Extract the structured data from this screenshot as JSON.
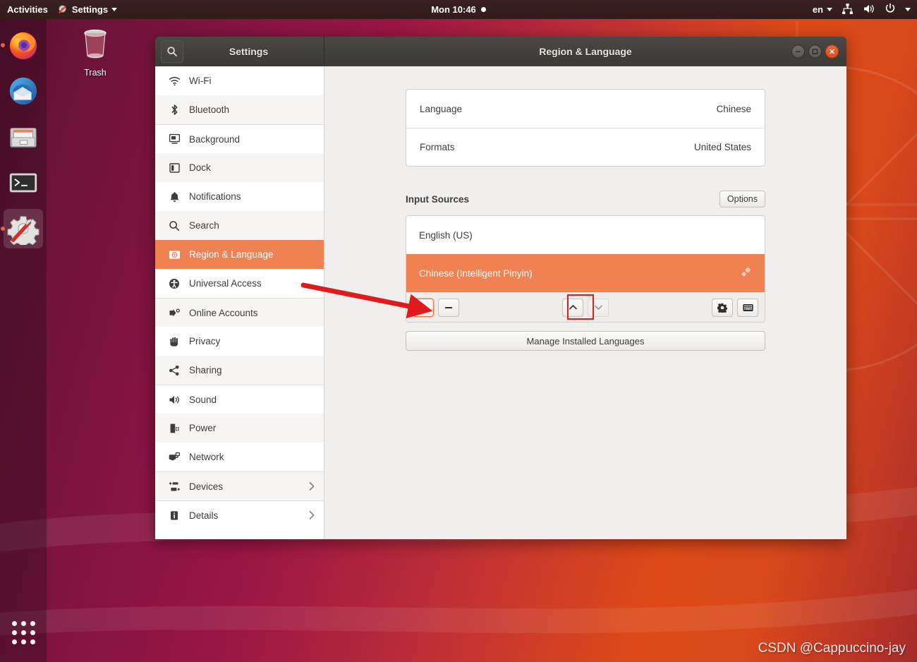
{
  "top_panel": {
    "activities_label": "Activities",
    "app_menu_label": "Settings",
    "app_menu_icon": "settings-icon",
    "clock_label": "Mon 10:46",
    "clock_indicator_icon": "recording-dot-icon",
    "keyboard_layout_label": "en",
    "network_icon": "network-wired-icon",
    "volume_icon": "volume-high-icon",
    "power_icon": "power-icon",
    "menu_caret_icon": "chevron-down-icon"
  },
  "dock": {
    "items": [
      {
        "name": "firefox",
        "label": "Firefox",
        "running": true,
        "active": false
      },
      {
        "name": "thunderbird",
        "label": "Thunderbird",
        "running": false,
        "active": false
      },
      {
        "name": "files",
        "label": "Files",
        "running": false,
        "active": false
      },
      {
        "name": "terminal",
        "label": "Terminal",
        "running": false,
        "active": false
      },
      {
        "name": "settings",
        "label": "Settings",
        "running": true,
        "active": true
      }
    ],
    "app_grid_label": "Show Applications"
  },
  "desktop": {
    "trash_label": "Trash",
    "watermark": "CSDN @Cappuccino-jay"
  },
  "window": {
    "search_icon": "search-icon",
    "sidebar_header_label": "Settings",
    "title": "Region & Language",
    "controls": {
      "minimize_icon": "minimize-icon",
      "maximize_icon": "maximize-icon",
      "close_icon": "close-icon"
    }
  },
  "sidebar": {
    "items": [
      {
        "label": "Wi-Fi",
        "icon": "wifi-icon",
        "selected": false,
        "submenu": false,
        "separator_above": false
      },
      {
        "label": "Bluetooth",
        "icon": "bluetooth-icon",
        "selected": false,
        "submenu": false,
        "separator_above": false
      },
      {
        "label": "Background",
        "icon": "background-icon",
        "selected": false,
        "submenu": false,
        "separator_above": true
      },
      {
        "label": "Dock",
        "icon": "dock-icon",
        "selected": false,
        "submenu": false,
        "separator_above": false
      },
      {
        "label": "Notifications",
        "icon": "bell-icon",
        "selected": false,
        "submenu": false,
        "separator_above": false
      },
      {
        "label": "Search",
        "icon": "search-icon",
        "selected": false,
        "submenu": false,
        "separator_above": false
      },
      {
        "label": "Region & Language",
        "icon": "region-language-icon",
        "selected": true,
        "submenu": false,
        "separator_above": false
      },
      {
        "label": "Universal Access",
        "icon": "accessibility-icon",
        "selected": false,
        "submenu": false,
        "separator_above": false
      },
      {
        "label": "Online Accounts",
        "icon": "online-accounts-icon",
        "selected": false,
        "submenu": false,
        "separator_above": true
      },
      {
        "label": "Privacy",
        "icon": "privacy-hand-icon",
        "selected": false,
        "submenu": false,
        "separator_above": false
      },
      {
        "label": "Sharing",
        "icon": "share-icon",
        "selected": false,
        "submenu": false,
        "separator_above": false
      },
      {
        "label": "Sound",
        "icon": "volume-icon",
        "selected": false,
        "submenu": false,
        "separator_above": true
      },
      {
        "label": "Power",
        "icon": "battery-icon",
        "selected": false,
        "submenu": false,
        "separator_above": false
      },
      {
        "label": "Network",
        "icon": "network-icon",
        "selected": false,
        "submenu": false,
        "separator_above": false
      },
      {
        "label": "Devices",
        "icon": "devices-icon",
        "selected": false,
        "submenu": true,
        "separator_above": true
      },
      {
        "label": "Details",
        "icon": "info-icon",
        "selected": false,
        "submenu": true,
        "separator_above": true
      }
    ]
  },
  "content": {
    "language_rows": [
      {
        "key": "Language",
        "value": "Chinese"
      },
      {
        "key": "Formats",
        "value": "United States"
      }
    ],
    "input_sources": {
      "section_title": "Input Sources",
      "options_button": "Options",
      "sources": [
        {
          "name": "English (US)",
          "selected": false,
          "has_prefs_icon": false
        },
        {
          "name": "Chinese (Intelligent Pinyin)",
          "selected": true,
          "has_prefs_icon": true,
          "prefs_icon": "preferences-gears-icon"
        }
      ],
      "toolbar": {
        "add_icon": "plus-icon",
        "remove_icon": "minus-icon",
        "move_up_icon": "chevron-up-icon",
        "move_down_icon": "chevron-down-icon",
        "settings_icon": "gear-icon",
        "keyboard_icon": "keyboard-icon"
      }
    },
    "manage_button": "Manage Installed Languages"
  },
  "annotation": {
    "arrow_color": "#e01b1b",
    "highlight_target": "move-up-button"
  },
  "colors": {
    "accent_orange": "#ef8152",
    "titlebar": "#3f3d3a",
    "content_bg": "#f0efee",
    "annotation_red": "#e01b1b"
  }
}
